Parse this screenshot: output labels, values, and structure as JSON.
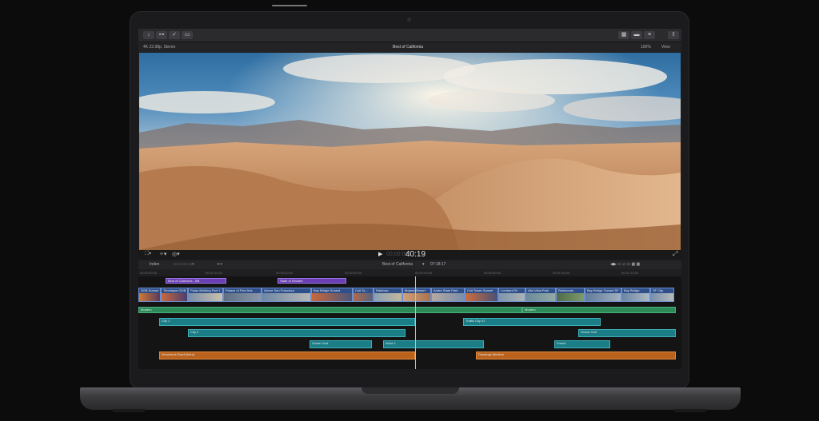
{
  "app": {
    "project_name": "Best of California",
    "format_info": "4K 23.98p, Stereo",
    "zoom": "100%",
    "view_menu": "View",
    "timecode": "40:19",
    "timecode_prefix": "00:00:00",
    "timeline_name": "Best of California",
    "duration": "07:18:17",
    "index_tab": "Index"
  },
  "ruler_ticks": [
    "00:00:00:00",
    "00:00:05:00",
    "00:00:10:00",
    "00:00:15:00",
    "00:00:20:00",
    "00:00:25:00",
    "00:00:30:00",
    "00:00:35:00",
    "00:00:40:00",
    "00:00:45:00",
    "00:00:50:00",
    "00:00:55:00",
    "00:01:00:00",
    "00:01:05:00",
    "00:01:10:00"
  ],
  "compound_clips": [
    "Best of California - BB",
    "State of Wonder"
  ],
  "video_clips": [
    "SGB Sunset",
    "Timelapse GGB",
    "Palau Building Part 1",
    "Palace of Fine Arts",
    "Above San Francisco",
    "Bay Bridge Sunset",
    "Coit To...",
    "Rainbow",
    "Mojave Desert",
    "Andre State Park",
    "Coit Tower Sunset",
    "Lombard St",
    "Alta Vista Park",
    "Redwoods",
    "Bay Bridge Toward SF",
    "Bay Bridge",
    "SF City"
  ],
  "audio": {
    "music1": "Modern",
    "music2": "Modern",
    "city1": "City 1",
    "city2": "City 2",
    "traffic": "Traffic City 01",
    "ocean1": "Ocean Surf",
    "wind": "Wind 2",
    "ocean2": "Ocean Surf",
    "forest": "Forest",
    "orange1": "Woodwork Swell (Intro)",
    "orange2": "Drawings Medium"
  },
  "colors": {
    "clip_blue": "#2e4f8a",
    "audio_green": "#2c8a58",
    "audio_teal": "#1b7d86",
    "music_orange": "#b9621e",
    "title_purple": "#6a3fb5",
    "playhead": "#d7c64a"
  }
}
